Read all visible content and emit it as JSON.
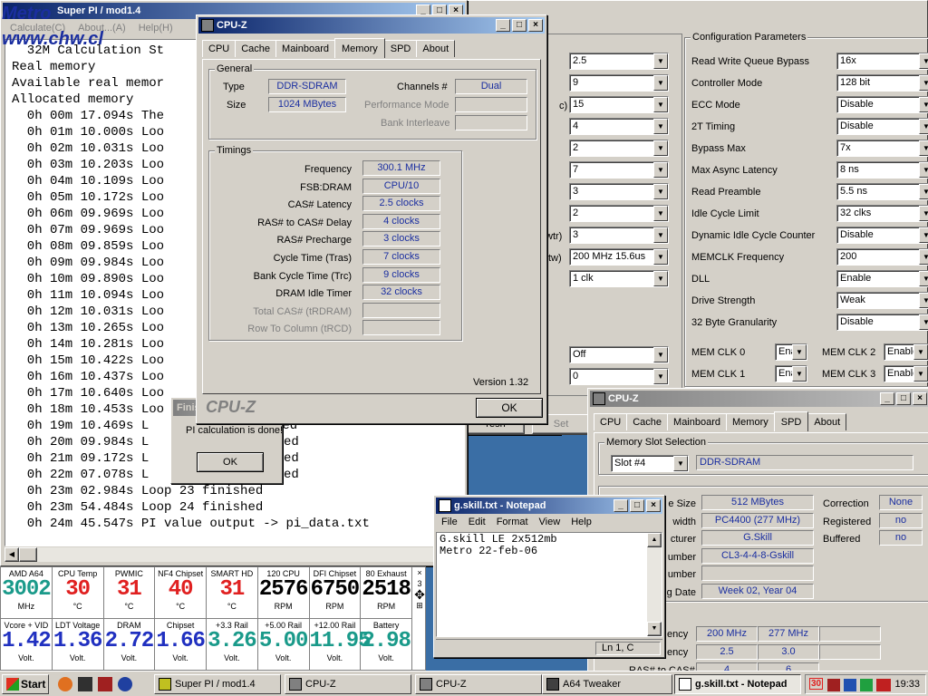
{
  "superpi": {
    "title": "Super PI / mod1.4",
    "menu": [
      "Calculate(C)",
      "About...(A)",
      "Help(H)"
    ],
    "overlay_logo_line1": "Metro",
    "overlay_logo_line2": "www.chw.cl",
    "header_lines": [
      "  32M Calculation St",
      "Real memory",
      "Available real memor",
      "Allocated memory"
    ],
    "lines": [
      "  0h 00m 17.094s The ",
      "  0h 01m 10.000s Loo",
      "  0h 02m 10.031s Loo",
      "  0h 03m 10.203s Loo",
      "  0h 04m 10.109s Loo",
      "  0h 05m 10.172s Loo",
      "  0h 06m 09.969s Loo",
      "  0h 07m 09.969s Loo",
      "  0h 08m 09.859s Loo",
      "  0h 09m 09.984s Loo",
      "  0h 10m 09.890s Loo",
      "  0h 11m 10.094s Loo",
      "  0h 12m 10.031s Loo",
      "  0h 13m 10.265s Loo",
      "  0h 14m 10.281s Loo",
      "  0h 15m 10.422s Loo",
      "  0h 16m 10.437s Loo",
      "  0h 17m 10.640s Loo",
      "  0h 18m 10.453s Loo",
      "  0h 19m 10.469s L",
      "  0h 20m 09.984s L",
      "  0h 21m 09.172s L",
      "  0h 22m 07.078s L",
      "  0h 23m 02.984s Loop 23 finished",
      "  0h 23m 54.484s Loop 24 finished",
      "  0h 24m 45.547s PI value output -> pi_data.txt"
    ],
    "finished_suffixes": [
      "finished",
      "inished",
      "inished",
      "inished"
    ]
  },
  "finish_dialog": {
    "title": "Finis",
    "message": "PI calculation is done!",
    "ok": "OK"
  },
  "cpuz_main": {
    "title": "CPU-Z",
    "tabs": [
      "CPU",
      "Cache",
      "Mainboard",
      "Memory",
      "SPD",
      "About"
    ],
    "active_tab": "Memory",
    "general_label": "General",
    "type_label": "Type",
    "type_value": "DDR-SDRAM",
    "size_label": "Size",
    "size_value": "1024 MBytes",
    "channels_label": "Channels #",
    "channels_value": "Dual",
    "perf_mode_label": "Performance Mode",
    "bank_interleave_label": "Bank Interleave",
    "timings_label": "Timings",
    "timings": [
      {
        "label": "Frequency",
        "value": "300.1 MHz"
      },
      {
        "label": "FSB:DRAM",
        "value": "CPU/10"
      },
      {
        "label": "CAS# Latency",
        "value": "2.5 clocks"
      },
      {
        "label": "RAS# to CAS# Delay",
        "value": "4 clocks"
      },
      {
        "label": "RAS# Precharge",
        "value": "3 clocks"
      },
      {
        "label": "Cycle Time (Tras)",
        "value": "7 clocks"
      },
      {
        "label": "Bank Cycle Time (Trc)",
        "value": "9 clocks"
      },
      {
        "label": "DRAM Idle Timer",
        "value": "32 clocks"
      },
      {
        "label": "Total CAS# (tRDRAM)",
        "value": ""
      },
      {
        "label": "Row To Column (tRCD)",
        "value": ""
      }
    ],
    "version": "Version 1.32",
    "brand": "CPU-Z",
    "ok": "OK"
  },
  "a64tweaker": {
    "left_combos": [
      "2.5",
      "9",
      "15",
      "4",
      "2",
      "7",
      "3",
      "2",
      "3",
      "200 MHz 15.6us",
      "1 clk"
    ],
    "left_partial_labels": [
      "c)",
      "wtr)",
      "tw)"
    ],
    "lower_combos": [
      "Off",
      "0"
    ],
    "partial_button_1": "resh",
    "partial_button_2": "Set",
    "config_title": "Configuration Parameters",
    "config": [
      {
        "label": "Read Write Queue Bypass",
        "value": "16x"
      },
      {
        "label": "Controller Mode",
        "value": "128 bit"
      },
      {
        "label": "ECC Mode",
        "value": "Disable"
      },
      {
        "label": "2T Timing",
        "value": "Disable"
      },
      {
        "label": "Bypass Max",
        "value": "7x"
      },
      {
        "label": "Max Async Latency",
        "value": "8 ns"
      },
      {
        "label": "Read Preamble",
        "value": "5.5 ns"
      },
      {
        "label": "Idle Cycle Limit",
        "value": "32 clks"
      },
      {
        "label": "Dynamic Idle Cycle Counter",
        "value": "Disable"
      },
      {
        "label": "MEMCLK Frequency",
        "value": "200"
      },
      {
        "label": "DLL",
        "value": "Enable"
      },
      {
        "label": "Drive Strength",
        "value": "Weak"
      },
      {
        "label": "32 Byte Granularity",
        "value": "Disable"
      }
    ],
    "memclk": [
      {
        "label": "MEM CLK 0",
        "value": "Enable"
      },
      {
        "label": "MEM CLK 2",
        "value": "Enable"
      },
      {
        "label": "MEM CLK 1",
        "value": "Enable"
      },
      {
        "label": "MEM CLK 3",
        "value": "Enable"
      }
    ]
  },
  "cpuz_spd": {
    "title": "CPU-Z",
    "tabs": [
      "CPU",
      "Cache",
      "Mainboard",
      "Memory",
      "SPD",
      "About"
    ],
    "active_tab": "SPD",
    "slot_group": "Memory Slot Selection",
    "slot": "Slot #4",
    "slot_type": "DDR-SDRAM",
    "partial_labels": [
      "e Size",
      "width",
      "cturer",
      "umber",
      "umber",
      "g Date"
    ],
    "values": [
      "512 MBytes",
      "PC4400 (277 MHz)",
      "G.Skill",
      "CL3-4-4-8-Gskill",
      "",
      "Week 02, Year 04"
    ],
    "right_labels": [
      {
        "label": "Correction",
        "value": "None"
      },
      {
        "label": "Registered",
        "value": "no"
      },
      {
        "label": "Buffered",
        "value": "no"
      }
    ],
    "table_label": "able",
    "freq_row_label": "ency",
    "freq_values": [
      "200 MHz",
      "277 MHz"
    ],
    "cas_row_label": "ency",
    "cas_values": [
      "2.5",
      "3.0"
    ],
    "ras_row_label": "RAS# to CAS#",
    "ras_values": [
      "4",
      "6"
    ]
  },
  "notepad": {
    "title": "g.skill.txt - Notepad",
    "menu": [
      "File",
      "Edit",
      "Format",
      "View",
      "Help"
    ],
    "text_line1": "G.skill LE 2x512mb",
    "text_line2": "Metro 22-feb-06",
    "status": "Ln 1, C"
  },
  "monitor": {
    "row1": [
      {
        "title": "AMD A64",
        "value": "3002",
        "unit": "MHz",
        "color": "#1a9a8a"
      },
      {
        "title": "CPU Temp",
        "value": "30",
        "unit": "°C",
        "color": "#e02020"
      },
      {
        "title": "PWMIC",
        "value": "31",
        "unit": "°C",
        "color": "#e02020"
      },
      {
        "title": "NF4 Chipset",
        "value": "40",
        "unit": "°C",
        "color": "#e02020"
      },
      {
        "title": "SMART HD",
        "value": "31",
        "unit": "°C",
        "color": "#e02020"
      },
      {
        "title": "120 CPU",
        "value": "2576",
        "unit": "RPM",
        "color": "#000000"
      },
      {
        "title": "DFI Chipset",
        "value": "6750",
        "unit": "RPM",
        "color": "#000000"
      },
      {
        "title": "80 Exhaust",
        "value": "2518",
        "unit": "RPM",
        "color": "#000000"
      }
    ],
    "row2": [
      {
        "title": "Vcore + VID",
        "value": "1.42",
        "unit": "Volt.",
        "color": "#2030c0"
      },
      {
        "title": "LDT Voltage",
        "value": "1.36",
        "unit": "Volt.",
        "color": "#2030c0"
      },
      {
        "title": "DRAM",
        "value": "2.72",
        "unit": "Volt.",
        "color": "#2030c0"
      },
      {
        "title": "Chipset",
        "value": "1.66",
        "unit": "Volt.",
        "color": "#2030c0"
      },
      {
        "title": "+3.3 Rail",
        "value": "3.26",
        "unit": "Volt.",
        "color": "#1a9a8a"
      },
      {
        "title": "+5.00 Rail",
        "value": "5.00",
        "unit": "Volt.",
        "color": "#1a9a8a"
      },
      {
        "title": "+12.00 Rail",
        "value": "11.95",
        "unit": "Volt.",
        "color": "#1a9a8a"
      },
      {
        "title": "Battery",
        "value": "2.98",
        "unit": "Volt.",
        "color": "#1a9a8a"
      }
    ],
    "side_number": "3"
  },
  "taskbar": {
    "start": "Start",
    "items": [
      "Super PI / mod1.4",
      "CPU-Z",
      "CPU-Z",
      "A64 Tweaker",
      "g.skill.txt - Notepad"
    ],
    "active_index": 4,
    "tray_text": "30",
    "clock": "19:33"
  },
  "colors": {
    "titlebar_active": "#0a246a",
    "desktop": "#3a6ea5",
    "value_text": "#1a2ea0"
  }
}
